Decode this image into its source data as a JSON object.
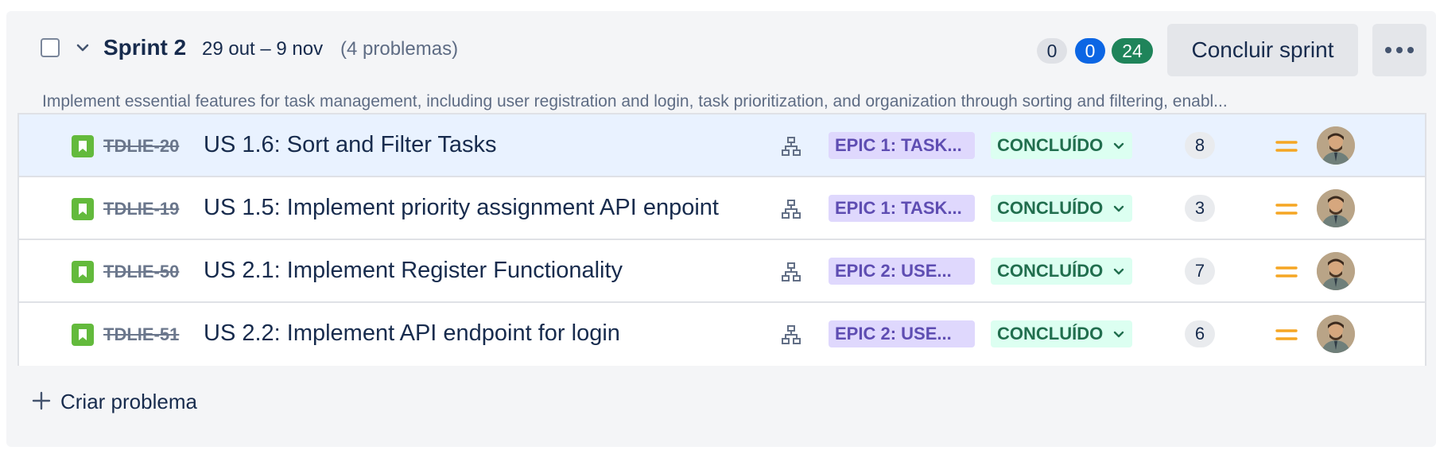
{
  "sprint": {
    "name": "Sprint 2",
    "dates": "29 out – 9 nov",
    "issue_count": "(4 problemas)",
    "counts": {
      "todo": "0",
      "in_progress": "0",
      "done": "24"
    },
    "complete_button": "Concluir sprint",
    "more_icon": "more-horizontal-icon",
    "goal": "Implement essential features for task management, including user registration and login, task prioritization, and organization through sorting and filtering, enabl..."
  },
  "issues": [
    {
      "key": "TDLIE-20",
      "summary": "US 1.6: Sort and Filter Tasks",
      "epic": "EPIC 1: TASK...",
      "status": "CONCLUÍDO",
      "points": "8",
      "selected": true
    },
    {
      "key": "TDLIE-19",
      "summary": "US 1.5: Implement priority assignment API enpoint",
      "epic": "EPIC 1: TASK...",
      "status": "CONCLUÍDO",
      "points": "3",
      "selected": false
    },
    {
      "key": "TDLIE-50",
      "summary": "US 2.1: Implement Register Functionality",
      "epic": "EPIC 2: USE...",
      "status": "CONCLUÍDO",
      "points": "7",
      "selected": false
    },
    {
      "key": "TDLIE-51",
      "summary": "US 2.2: Implement API endpoint for login",
      "epic": "EPIC 2: USE...",
      "status": "CONCLUÍDO",
      "points": "6",
      "selected": false
    }
  ],
  "icons": {
    "issue_type": "story-icon",
    "hierarchy": "child-issues-icon",
    "priority": "medium-priority-icon",
    "status_dropdown": "chevron-down-icon"
  },
  "create_issue": "Criar problema",
  "colors": {
    "story": "#63ba3c",
    "epic_bg": "#dfd8fd",
    "epic_text": "#5e4db2",
    "done_bg": "#dcfff1",
    "done_text": "#216e4e",
    "in_progress": "#0c66e4",
    "done_count": "#1f845a",
    "priority": "#f5a623"
  }
}
